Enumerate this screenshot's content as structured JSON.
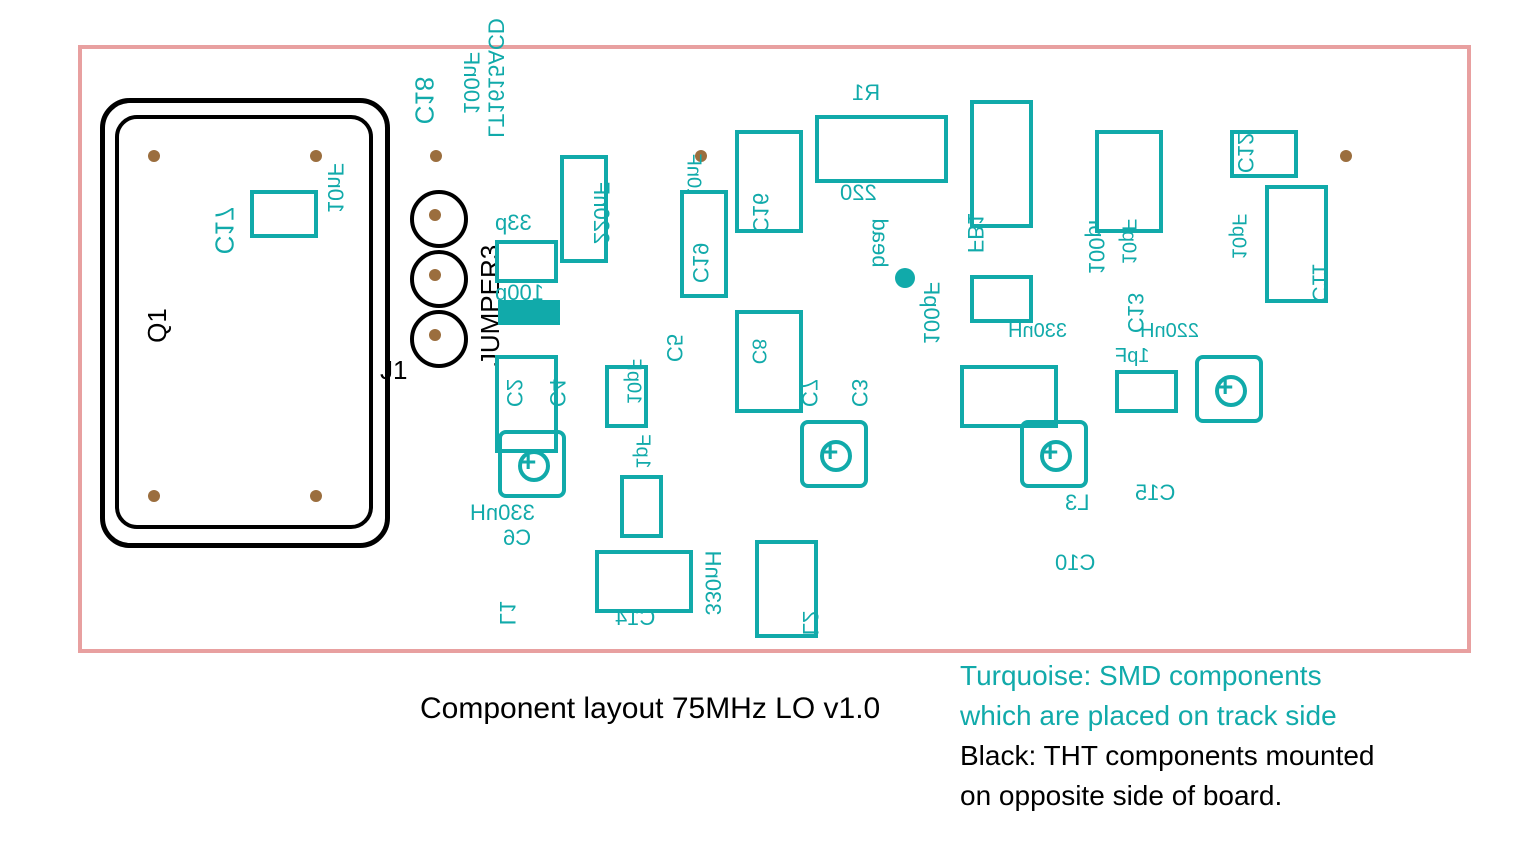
{
  "caption": "Component layout 75MHz LO v1.0",
  "legend": {
    "turquoise_line1": "Turquoise: SMD components",
    "turquoise_line2": "which are placed on track side",
    "black_line1": "Black: THT components mounted",
    "black_line2": "on opposite side of board."
  },
  "labels": {
    "q1": "Q1",
    "j1": "J1",
    "jumper3": "JUMPER3",
    "c17": "C17",
    "c18": "C18",
    "lt1615acd": "LT1615ACD",
    "100nf": "100nF",
    "10nf": "10nF",
    "33p": "33p",
    "100p": "100p",
    "220nf": "220nF",
    "c2": "C2",
    "c4": "C4",
    "c6": "C6",
    "l1": "L1",
    "330nh1": "330nH",
    "c5": "C5",
    "c14": "C14",
    "l2": "L2",
    "330nh2": "330nH",
    "10pf1": "10pF",
    "1pf1": "1pF",
    "c16": "C16",
    "c19": "C19",
    "10nf2": "10nF",
    "c7": "C7",
    "c3": "C3",
    "c8": "C8",
    "100pf1": "100pF",
    "r1": "R1",
    "220": "220",
    "bead": "bead",
    "fb1": "FB1",
    "c9": "C9",
    "330nh3": "330nH",
    "l3": "L3",
    "c10": "C10",
    "100pf2": "100pF",
    "10pf2": "10pF",
    "c13": "C13",
    "c15": "C15",
    "1pf2": "1pF",
    "c12": "C12",
    "10pf3": "10pF",
    "c11": "C11",
    "220nh": "220nH"
  },
  "colors": {
    "turquoise": "#1aa",
    "pink_border": "#e8a0a0",
    "pad_brown": "#9b6e3e"
  },
  "components": [
    {
      "ref": "Q1",
      "type": "THT",
      "shape": "crystal"
    },
    {
      "ref": "J1",
      "type": "THT",
      "shape": "jumper3"
    },
    {
      "ref": "C17",
      "type": "SMD",
      "value": "10nF"
    },
    {
      "ref": "C18",
      "type": "SMD",
      "value": "100nF"
    },
    {
      "ref": "LT1615ACD",
      "type": "SMD",
      "shape": "ic"
    },
    {
      "ref": "C2",
      "type": "SMD",
      "value": "100p"
    },
    {
      "ref": "C4",
      "type": "SMD",
      "value": "10pF"
    },
    {
      "ref": "C5",
      "type": "SMD",
      "value": "1pF"
    },
    {
      "ref": "C6",
      "type": "SMD",
      "value": "330nH"
    },
    {
      "ref": "L1",
      "type": "SMD"
    },
    {
      "ref": "L2",
      "type": "SMD",
      "value": "330nH"
    },
    {
      "ref": "C14",
      "type": "SMD"
    },
    {
      "ref": "C19",
      "type": "SMD",
      "value": "220nF"
    },
    {
      "ref": "C16",
      "type": "SMD",
      "value": "10nF"
    },
    {
      "ref": "R1",
      "type": "SMD",
      "value": "220"
    },
    {
      "ref": "C7",
      "type": "SMD"
    },
    {
      "ref": "C3",
      "type": "SMD"
    },
    {
      "ref": "C8",
      "type": "SMD",
      "value": "100pF"
    },
    {
      "ref": "FB1",
      "type": "SMD",
      "value": "bead"
    },
    {
      "ref": "C9",
      "type": "SMD",
      "value": "100pF"
    },
    {
      "ref": "L3",
      "type": "SMD",
      "value": "330nH"
    },
    {
      "ref": "C10",
      "type": "SMD"
    },
    {
      "ref": "C13",
      "type": "SMD",
      "value": "10pF"
    },
    {
      "ref": "C15",
      "type": "SMD",
      "value": "1pF"
    },
    {
      "ref": "C12",
      "type": "SMD"
    },
    {
      "ref": "C11",
      "type": "SMD",
      "value": "10pF"
    },
    {
      "ref": "trimmer1",
      "type": "SMD",
      "shape": "trimmer"
    },
    {
      "ref": "trimmer2",
      "type": "SMD",
      "shape": "trimmer"
    },
    {
      "ref": "trimmer3",
      "type": "SMD",
      "shape": "trimmer"
    },
    {
      "ref": "trimmer4",
      "type": "SMD",
      "shape": "trimmer"
    }
  ]
}
